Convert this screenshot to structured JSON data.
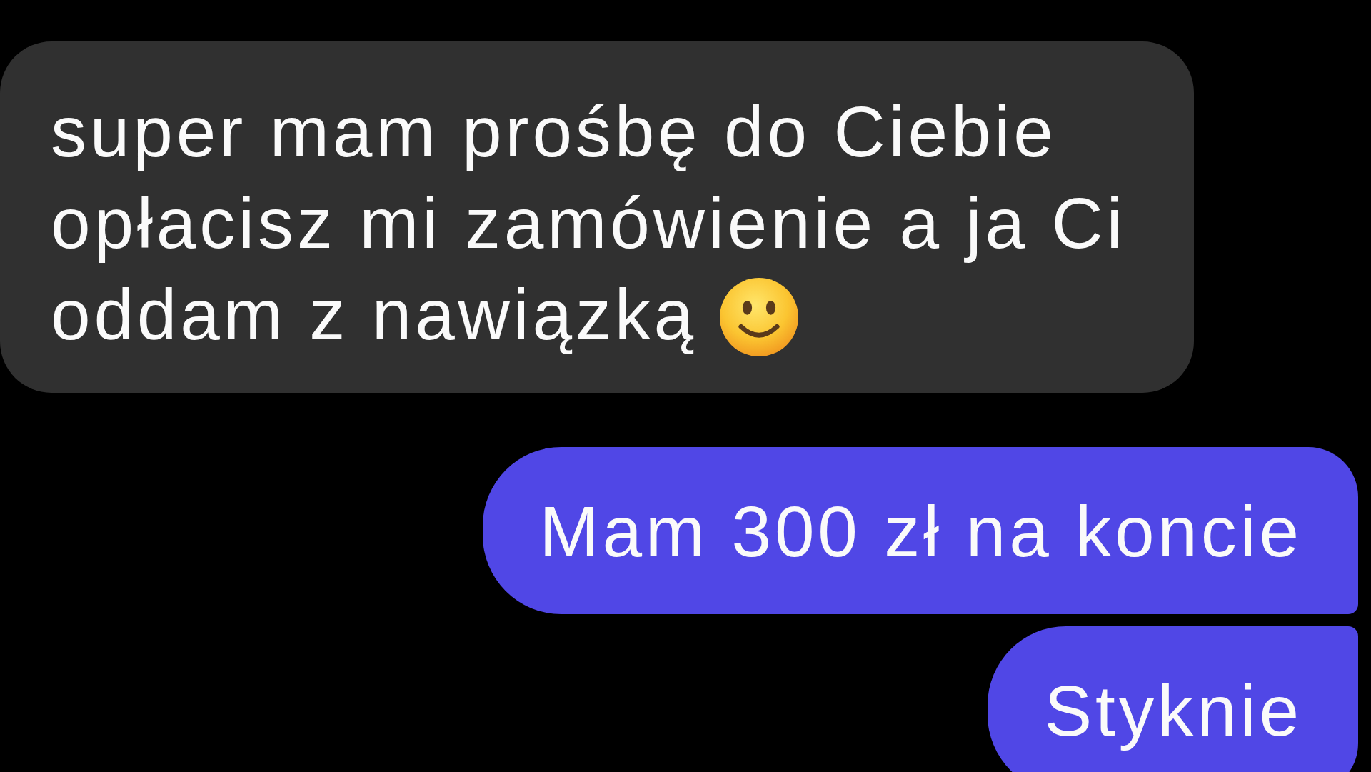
{
  "messages": [
    {
      "kind": "received",
      "lines": [
        "super mam prośbę do Ciebie",
        "opłacisz mi zamówienie a ja Ci",
        "oddam z nawiązką"
      ],
      "emoji": true
    },
    {
      "kind": "sent",
      "lines": [
        "Mam 300 zł na koncie"
      ],
      "emoji": false
    },
    {
      "kind": "sent",
      "lines": [
        "Styknie"
      ],
      "emoji": false
    }
  ]
}
